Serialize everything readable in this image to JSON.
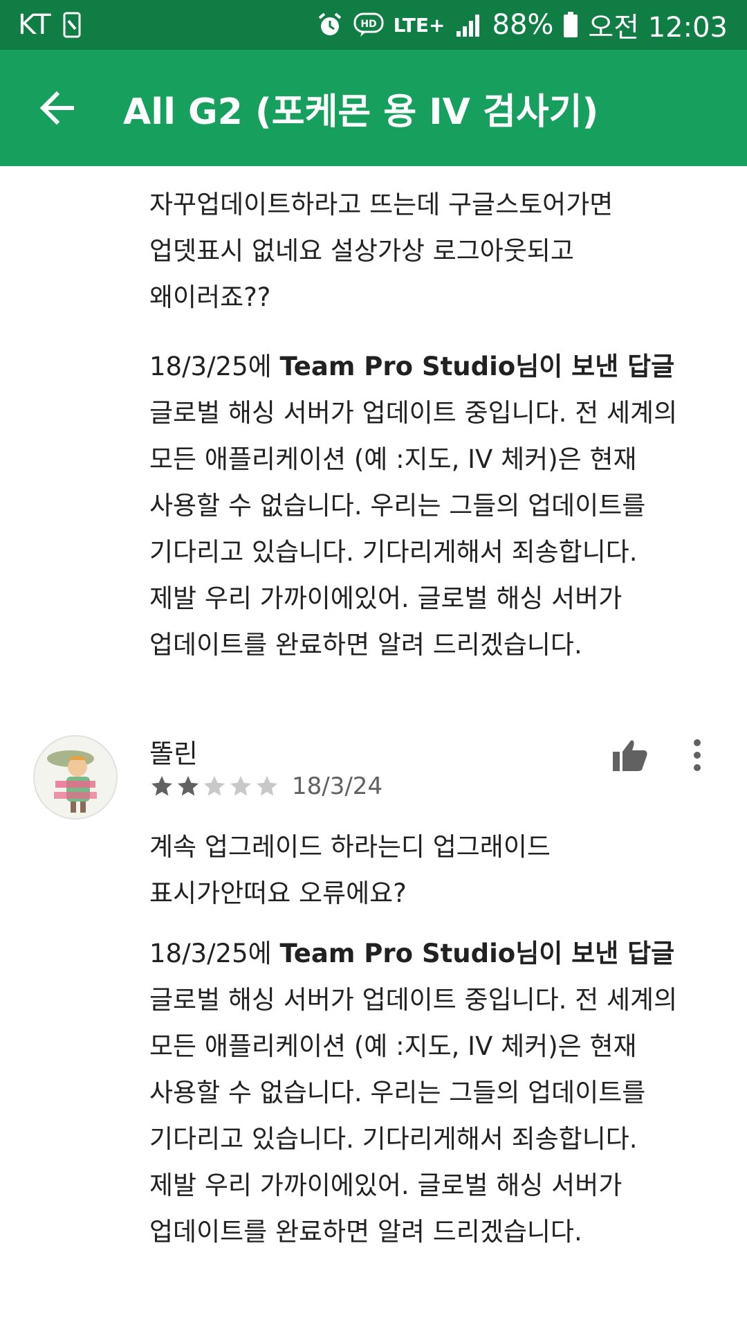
{
  "status_bar": {
    "carrier": "KT",
    "network": "LTE+",
    "battery": "88%",
    "time": "오전 12:03"
  },
  "app_bar": {
    "title": "All G2 (포케몬 용 IV 검사기)"
  },
  "review1": {
    "text": "자꾸업데이트하라고 뜨는데 구글스토어가면\n업뎃표시 없네요 설상가상 로그아웃되고\n왜이러죠??",
    "reply": {
      "date": "18/3/25에",
      "developer": "Team Pro Studio",
      "suffix": "님이 보낸 답글",
      "text": "글로벌 해싱 서버가 업데이트 중입니다. 전 세계의\n모든 애플리케이션 (예 :지도, IV 체커)은 현재\n사용할 수 없습니다. 우리는 그들의 업데이트를\n기다리고 있습니다. 기다리게해서 죄송합니다.\n제발 우리 가까이에있어. 글로벌 해싱 서버가\n업데이트를 완료하면 알려 드리겠습니다."
    }
  },
  "review2": {
    "author": "똘린",
    "rating": 2,
    "rating_max": 5,
    "date": "18/3/24",
    "text": "계속 업그레이드 하라는디 업그래이드\n표시가안떠요 오류에요?",
    "reply": {
      "date": "18/3/25에",
      "developer": "Team Pro Studio",
      "suffix": "님이 보낸 답글",
      "text": "글로벌 해싱 서버가 업데이트 중입니다. 전 세계의\n모든 애플리케이션 (예 :지도, IV 체커)은 현재\n사용할 수 없습니다. 우리는 그들의 업데이트를\n기다리고 있습니다. 기다리게해서 죄송합니다.\n제발 우리 가까이에있어. 글로벌 해싱 서버가\n업데이트를 완료하면 알려 드리겠습니다."
    }
  },
  "colors": {
    "status_bar": "#0f7d44",
    "app_bar": "#17a05d",
    "star_filled": "#616161",
    "star_empty": "#c8c8c8"
  },
  "icons": [
    "notification-icon",
    "alarm-icon",
    "hd-voice-icon",
    "signal-icon",
    "battery-icon",
    "back-arrow-icon",
    "thumbs-up-icon",
    "more-vert-icon",
    "star-icon"
  ]
}
